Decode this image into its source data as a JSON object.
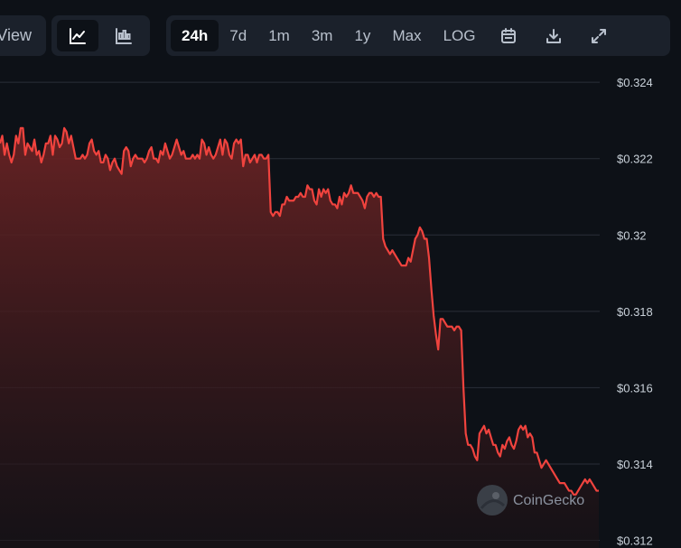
{
  "toolbar": {
    "view_label": "View",
    "chart_types": [
      {
        "name": "line-chart-icon",
        "active": true
      },
      {
        "name": "candlestick-chart-icon",
        "active": false
      }
    ],
    "ranges": [
      {
        "label": "24h",
        "active": true
      },
      {
        "label": "7d",
        "active": false
      },
      {
        "label": "1m",
        "active": false
      },
      {
        "label": "3m",
        "active": false
      },
      {
        "label": "1y",
        "active": false
      },
      {
        "label": "Max",
        "active": false
      },
      {
        "label": "LOG",
        "active": false
      }
    ],
    "icons": [
      "calendar-icon",
      "download-icon",
      "fullscreen-icon"
    ]
  },
  "watermark": "CoinGecko",
  "colors": {
    "line": "#f0433e",
    "fill_top": "#6b2324",
    "fill_bottom": "#1a1216",
    "grid": "#2a2f38",
    "background": "#0d1117"
  },
  "chart_data": {
    "type": "area",
    "title": "",
    "xlabel": "",
    "ylabel": "",
    "ylim": [
      0.3118,
      0.3245
    ],
    "y_ticks": [
      {
        "value": 0.324,
        "label": "$0.324"
      },
      {
        "value": 0.322,
        "label": "$0.322"
      },
      {
        "value": 0.32,
        "label": "$0.32"
      },
      {
        "value": 0.318,
        "label": "$0.318"
      },
      {
        "value": 0.316,
        "label": "$0.316"
      },
      {
        "value": 0.314,
        "label": "$0.314"
      },
      {
        "value": 0.312,
        "label": "$0.312"
      }
    ],
    "grid": true,
    "series": [
      {
        "values": [
          0.3224,
          0.3226,
          0.3221,
          0.3224,
          0.3221,
          0.3219,
          0.3221,
          0.3226,
          0.3224,
          0.3228,
          0.3228,
          0.3221,
          0.3224,
          0.3223,
          0.3222,
          0.3225,
          0.3221,
          0.3222,
          0.3219,
          0.3221,
          0.3224,
          0.3224,
          0.3226,
          0.3221,
          0.3226,
          0.3225,
          0.3223,
          0.3224,
          0.3228,
          0.3227,
          0.3224,
          0.3226,
          0.3223,
          0.322,
          0.322,
          0.322,
          0.3221,
          0.322,
          0.3221,
          0.3224,
          0.3225,
          0.3222,
          0.3221,
          0.3222,
          0.3219,
          0.3219,
          0.3221,
          0.322,
          0.3217,
          0.3219,
          0.322,
          0.3218,
          0.3217,
          0.3216,
          0.3222,
          0.3223,
          0.3222,
          0.3218,
          0.322,
          0.3221,
          0.322,
          0.322,
          0.322,
          0.3219,
          0.322,
          0.3222,
          0.3223,
          0.322,
          0.322,
          0.3219,
          0.3222,
          0.3221,
          0.3224,
          0.3222,
          0.322,
          0.3221,
          0.3223,
          0.3225,
          0.3223,
          0.3221,
          0.3222,
          0.322,
          0.322,
          0.322,
          0.3221,
          0.322,
          0.3221,
          0.322,
          0.3225,
          0.3224,
          0.3221,
          0.3223,
          0.3221,
          0.322,
          0.3221,
          0.3223,
          0.3225,
          0.3221,
          0.3225,
          0.3224,
          0.3221,
          0.322,
          0.3224,
          0.3225,
          0.3224,
          0.3225,
          0.3218,
          0.3221,
          0.3221,
          0.3219,
          0.322,
          0.3221,
          0.3219,
          0.3221,
          0.3221,
          0.322,
          0.322,
          0.3221,
          0.3206,
          0.3205,
          0.3206,
          0.3206,
          0.3205,
          0.3208,
          0.3208,
          0.321,
          0.3209,
          0.3209,
          0.3209,
          0.321,
          0.321,
          0.3211,
          0.321,
          0.321,
          0.3213,
          0.3212,
          0.3212,
          0.3209,
          0.3208,
          0.3212,
          0.321,
          0.3212,
          0.3211,
          0.3212,
          0.3209,
          0.3208,
          0.3208,
          0.3207,
          0.321,
          0.3208,
          0.3211,
          0.321,
          0.3211,
          0.3213,
          0.3211,
          0.3211,
          0.3211,
          0.321,
          0.3209,
          0.3207,
          0.321,
          0.3211,
          0.3211,
          0.321,
          0.3211,
          0.321,
          0.321,
          0.3199,
          0.3197,
          0.3196,
          0.3195,
          0.3196,
          0.3195,
          0.3194,
          0.3193,
          0.3192,
          0.3192,
          0.3192,
          0.3194,
          0.3193,
          0.3196,
          0.3199,
          0.32,
          0.3202,
          0.3201,
          0.3199,
          0.3199,
          0.3194,
          0.3186,
          0.3179,
          0.3174,
          0.317,
          0.3178,
          0.3178,
          0.3177,
          0.3176,
          0.3176,
          0.3176,
          0.3175,
          0.3176,
          0.3176,
          0.3175,
          0.316,
          0.3148,
          0.3145,
          0.3145,
          0.3144,
          0.3142,
          0.3141,
          0.3148,
          0.3149,
          0.315,
          0.3148,
          0.3149,
          0.3147,
          0.3145,
          0.3145,
          0.3143,
          0.3142,
          0.3145,
          0.3144,
          0.3146,
          0.3147,
          0.3145,
          0.3144,
          0.3146,
          0.3149,
          0.315,
          0.3149,
          0.315,
          0.3147,
          0.3148,
          0.3147,
          0.3143,
          0.3143,
          0.3141,
          0.3139,
          0.314,
          0.3141,
          0.314,
          0.3139,
          0.3138,
          0.3137,
          0.3136,
          0.3135,
          0.3135,
          0.3135,
          0.3134,
          0.3133,
          0.3133,
          0.3132,
          0.3132,
          0.3133,
          0.3134,
          0.3135,
          0.3136,
          0.3135,
          0.3136,
          0.3135,
          0.3134,
          0.3133,
          0.3133
        ]
      }
    ]
  }
}
